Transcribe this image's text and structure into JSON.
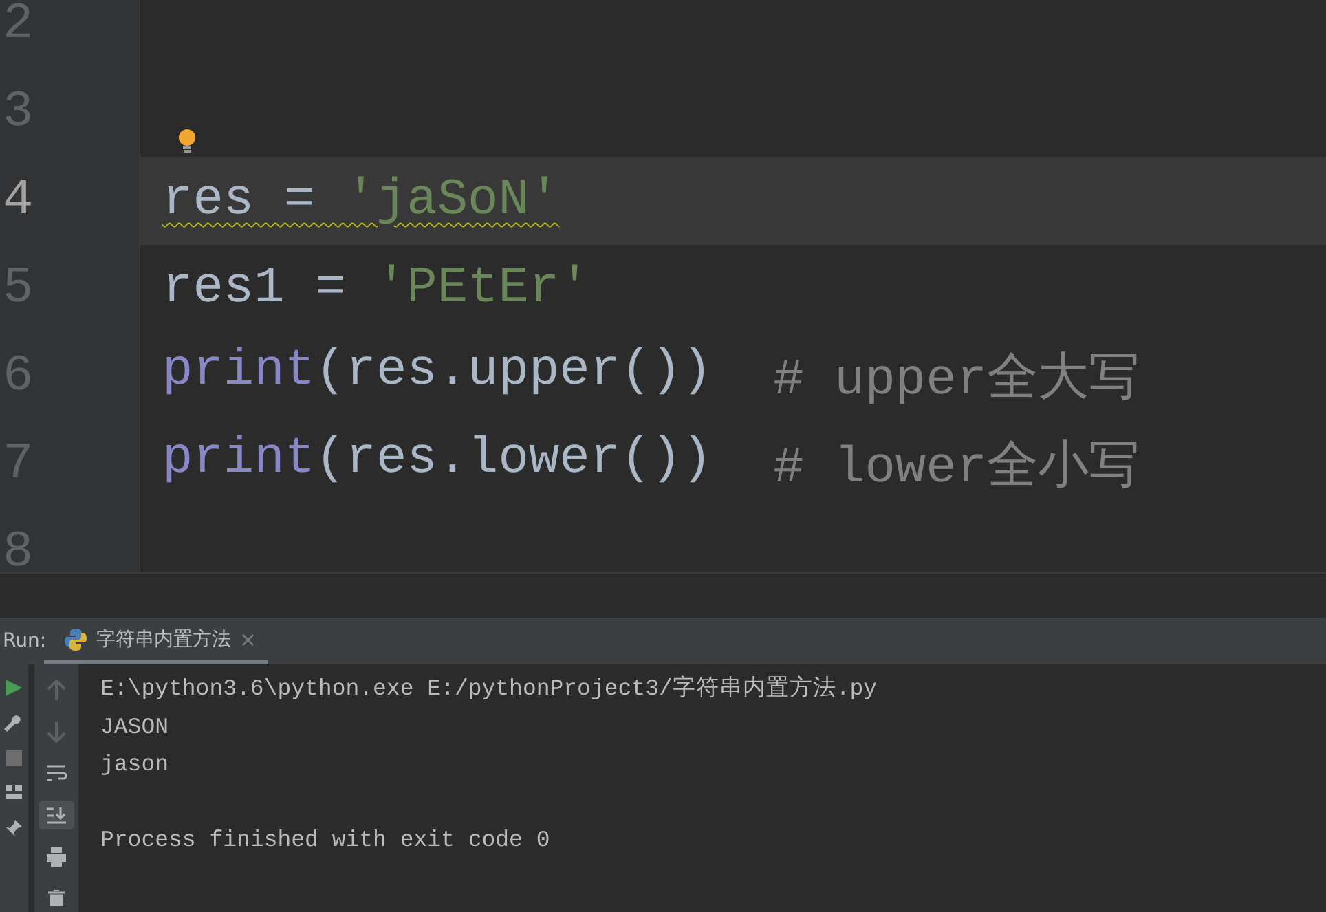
{
  "editor": {
    "lines": [
      {
        "number": "2",
        "current": false,
        "hint": false
      },
      {
        "number": "3",
        "current": false,
        "hint": true
      },
      {
        "number": "4",
        "current": true,
        "warning": true,
        "hint": false,
        "tokens": [
          {
            "kind": "name",
            "text": "res = "
          },
          {
            "kind": "string",
            "text": "'jaSoN'"
          }
        ]
      },
      {
        "number": "5",
        "current": false,
        "warning": false,
        "hint": false,
        "tokens": [
          {
            "kind": "name",
            "text": "res1 = "
          },
          {
            "kind": "string",
            "text": "'PEtEr'"
          }
        ]
      },
      {
        "number": "6",
        "current": false,
        "warning": false,
        "hint": false,
        "tokens": [
          {
            "kind": "builtin",
            "text": "print"
          },
          {
            "kind": "name",
            "text": "(res.upper())  "
          },
          {
            "kind": "comment",
            "text": "# upper全大写"
          }
        ]
      },
      {
        "number": "7",
        "current": false,
        "warning": false,
        "hint": false,
        "tokens": [
          {
            "kind": "builtin",
            "text": "print"
          },
          {
            "kind": "name",
            "text": "(res.lower())  "
          },
          {
            "kind": "comment",
            "text": "# lower全小写"
          }
        ]
      },
      {
        "number": "8",
        "current": false,
        "hint": false
      }
    ]
  },
  "run_panel": {
    "label": "Run:",
    "tabs": [
      {
        "title": "字符串内置方法",
        "selected": true,
        "close": "×"
      }
    ],
    "console": [
      {
        "kind": "command",
        "text": "E:\\python3.6\\python.exe E:/pythonProject3/字符串内置方法.py"
      },
      {
        "kind": "output",
        "text": "JASON"
      },
      {
        "kind": "output",
        "text": "jason"
      },
      {
        "kind": "exit",
        "text": "Process finished with exit code 0"
      }
    ]
  }
}
